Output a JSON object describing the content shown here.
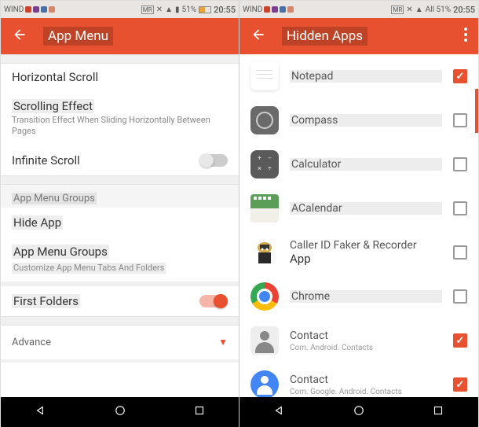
{
  "status": {
    "carrier": "WIND",
    "mr": "MR",
    "signal_text": "All 51%",
    "signal_text_left": "51%",
    "time": "20:55"
  },
  "left": {
    "title": "App Menu",
    "rows": {
      "horizontal_scroll": "Horizontal Scroll",
      "scrolling_effect": "Scrolling Effect",
      "scrolling_sub_a": "Transition Effect",
      "scrolling_sub_b": "When Sliding Horizontally Between Pages",
      "infinite_scroll": "Infinite Scroll",
      "groups_header": "App Menu Groups",
      "hide_app": "Hide App",
      "groups_title": "App Menu Groups",
      "groups_sub": "Customize App Menu Tabs And Folders",
      "first_folders": "First Folders",
      "advance": "Advance"
    }
  },
  "right": {
    "title": "Hidden Apps",
    "apps": [
      {
        "name": "Notepad",
        "sub": "",
        "checked": true
      },
      {
        "name": "Compass",
        "sub": "",
        "checked": false
      },
      {
        "name": "Calculator",
        "sub": "",
        "checked": false
      },
      {
        "name": "ACalendar",
        "sub": "",
        "checked": false
      },
      {
        "name": "Caller ID Faker & Recorder",
        "boldPart": "App",
        "sub": "",
        "checked": false
      },
      {
        "name": "Chrome",
        "sub": "",
        "checked": false
      },
      {
        "name": "Contact",
        "sub": "Com. Android. Contacts",
        "checked": true
      },
      {
        "name": "Contact",
        "sub": "Com. Google. Android. Contacts",
        "checked": true
      }
    ]
  }
}
